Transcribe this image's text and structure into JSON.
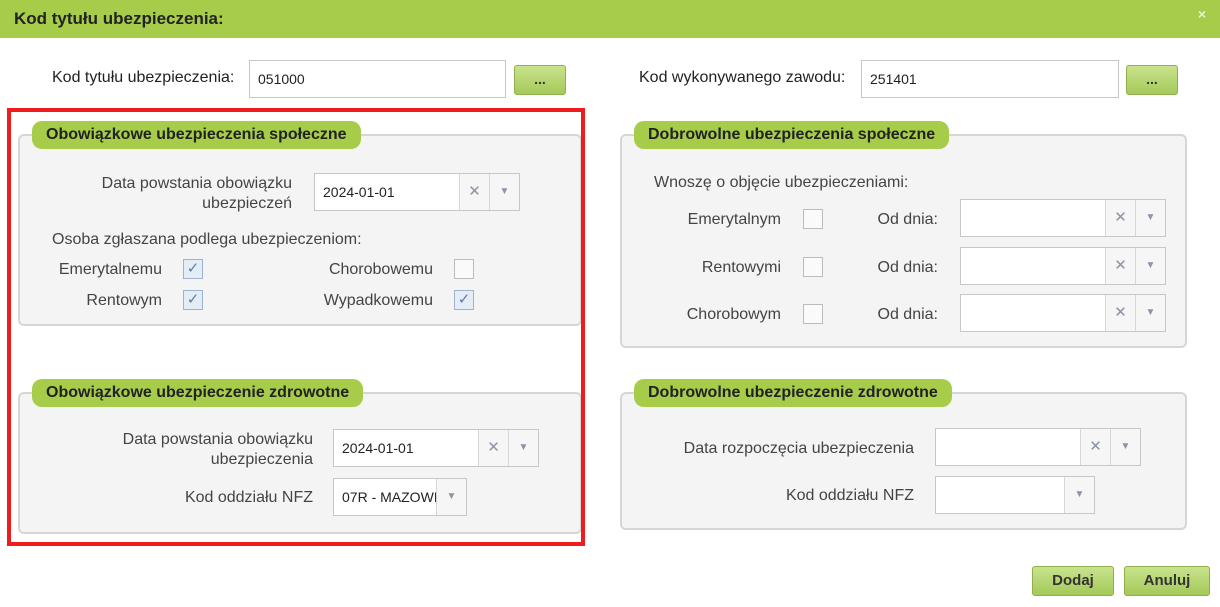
{
  "dialog": {
    "title": "Kod tytułu ubezpieczenia:",
    "close_glyph": "×"
  },
  "top": {
    "kod_tytulu_label": "Kod tytułu ubezpieczenia:",
    "kod_tytulu_value": "051000",
    "kod_zawodu_label": "Kod wykonywanego zawodu:",
    "kod_zawodu_value": "251401",
    "dots_label": "..."
  },
  "obowiazkowe_spoleczne": {
    "legend": "Obowiązkowe ubezpieczenia społeczne",
    "date_label_line1": "Data powstania obowiązku",
    "date_label_line2": "ubezpieczeń",
    "date_value": "2024-01-01",
    "subheader": "Osoba zgłaszana podlega ubezpieczeniom:",
    "items": [
      {
        "label": "Emerytalnemu",
        "checked": true
      },
      {
        "label": "Chorobowemu",
        "checked": false
      },
      {
        "label": "Rentowym",
        "checked": true
      },
      {
        "label": "Wypadkowemu",
        "checked": true
      }
    ]
  },
  "obowiazkowe_zdrowotne": {
    "legend": "Obowiązkowe ubezpieczenie zdrowotne",
    "date_label_line1": "Data powstania obowiązku",
    "date_label_line2": "ubezpieczenia",
    "date_value": "2024-01-01",
    "nfz_label": "Kod oddziału NFZ",
    "nfz_value": "07R - MAZOWI"
  },
  "dobrowolne_spoleczne": {
    "legend": "Dobrowolne ubezpieczenia społeczne",
    "subheader": "Wnoszę o objęcie ubezpieczeniami:",
    "od_dnia_label": "Od dnia:",
    "items": [
      {
        "label": "Emerytalnym",
        "checked": false,
        "date": ""
      },
      {
        "label": "Rentowymi",
        "checked": false,
        "date": ""
      },
      {
        "label": "Chorobowym",
        "checked": false,
        "date": ""
      }
    ]
  },
  "dobrowolne_zdrowotne": {
    "legend": "Dobrowolne ubezpieczenie zdrowotne",
    "date_label": "Data rozpoczęcia ubezpieczenia",
    "date_value": "",
    "nfz_label": "Kod oddziału NFZ",
    "nfz_value": ""
  },
  "icons": {
    "clear": "✕",
    "dropdown": "▼",
    "check": "✓"
  },
  "buttons": {
    "add": "Dodaj",
    "cancel": "Anuluj"
  },
  "colors": {
    "accent_green": "#a6cc4a",
    "highlight_red": "#ee1c1c"
  }
}
